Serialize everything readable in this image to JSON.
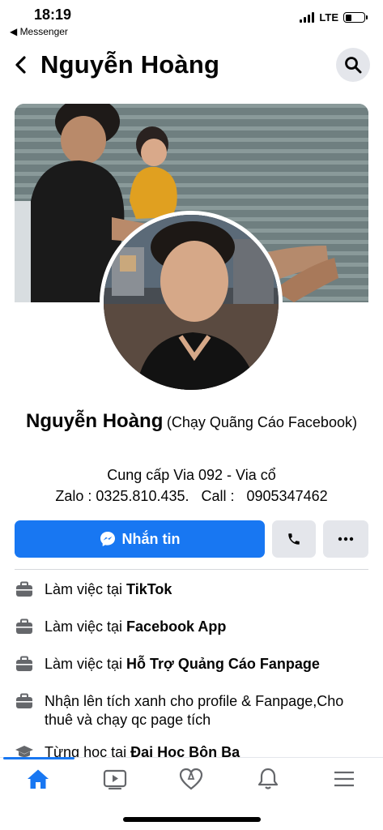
{
  "status_bar": {
    "time": "18:19",
    "back_app": "◀ Messenger",
    "network": "LTE",
    "battery_level": 0.35
  },
  "header": {
    "title": "Nguyễn Hoàng"
  },
  "profile": {
    "name": "Nguyễn Hoàng",
    "name_suffix": "(Chạy Quãng Cáo Facebook)",
    "bio_line1": "Cung cấp Via 092 - Via cổ",
    "bio_line2": "Zalo : 0325.810.435.   Call :   0905347462"
  },
  "actions": {
    "message_label": "Nhắn tin",
    "call_icon": "phone-icon",
    "more_icon": "more-icon"
  },
  "details": [
    {
      "prefix": "Làm việc tại ",
      "bold": "TikTok",
      "icon": "briefcase-icon"
    },
    {
      "prefix": "Làm việc tại ",
      "bold": "Facebook App",
      "icon": "briefcase-icon"
    },
    {
      "prefix": "Làm việc tại ",
      "bold": "Hỗ Trợ Quảng Cáo Fanpage",
      "icon": "briefcase-icon"
    },
    {
      "prefix": "Nhận lên tích xanh cho profile & Fanpage,Cho thuê và chạy qc page tích",
      "bold": "",
      "icon": "briefcase-icon"
    },
    {
      "prefix": "Từng học tại ",
      "bold": "Đại Học Bôn Ba",
      "icon": "graduation-cap-icon"
    }
  ],
  "bottom_nav": {
    "items": [
      "home-icon",
      "watch-icon",
      "dating-icon",
      "notifications-icon",
      "menu-icon"
    ],
    "active": "home-icon"
  },
  "colors": {
    "accent": "#1877f2",
    "secondary_button": "#e4e6eb"
  }
}
